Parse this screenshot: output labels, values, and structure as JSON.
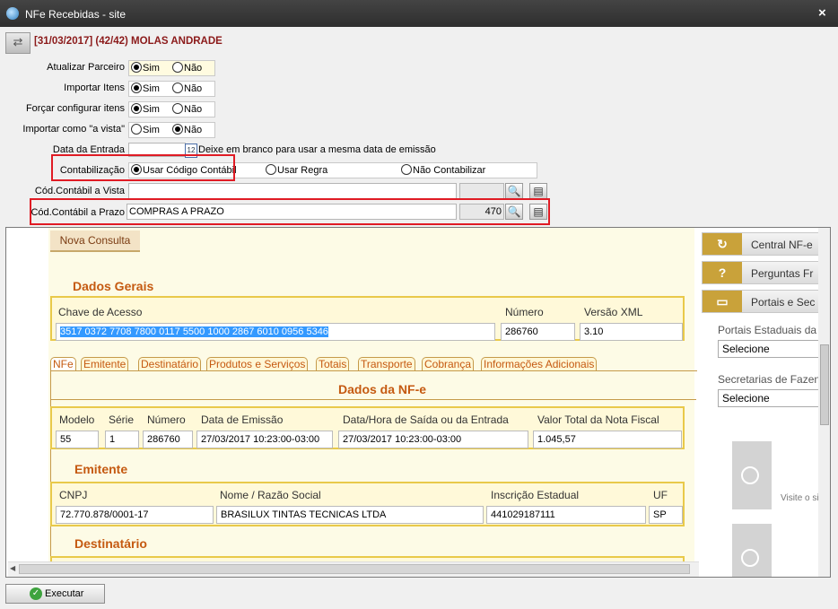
{
  "window": {
    "title": "NFe Recebidas - site",
    "close": "×"
  },
  "header": {
    "title": "[31/03/2017] (42/42) MOLAS ANDRADE"
  },
  "form": {
    "atualizar_parceiro": {
      "label": "Atualizar Parceiro",
      "options": [
        "Sim",
        "Não"
      ],
      "selected": "Sim"
    },
    "importar_itens": {
      "label": "Importar Itens",
      "options": [
        "Sim",
        "Não"
      ],
      "selected": "Sim"
    },
    "forcar_configurar": {
      "label": "Forçar configurar itens",
      "options": [
        "Sim",
        "Não"
      ],
      "selected": "Sim"
    },
    "importar_vista": {
      "label": "Importar como \"a vista\"",
      "options": [
        "Sim",
        "Não"
      ],
      "selected": "Não"
    },
    "data_entrada": {
      "label": "Data da Entrada",
      "value": "",
      "hint": "Deixe em branco para usar a mesma data de emissão",
      "calendar_num": "12"
    },
    "contabilizacao": {
      "label": "Contabilização",
      "options": [
        "Usar Código Contábil",
        "Usar Regra",
        "Não Contabilizar"
      ],
      "selected": "Usar Código Contábil"
    },
    "cod_vista": {
      "label": "Cód.Contábil a Vista",
      "value": "",
      "code": ""
    },
    "cod_prazo": {
      "label": "Cód.Contábil a Prazo",
      "value": "COMPRAS A PRAZO",
      "code": "470"
    }
  },
  "browser": {
    "nova_consulta": "Nova Consulta",
    "dados_gerais": {
      "title": "Dados Gerais",
      "chave_label": "Chave de Acesso",
      "chave_value": "3517 0372 7708 7800 0117 5500 1000 2867 6010 0956 5346",
      "numero_label": "Número",
      "numero_value": "286760",
      "versao_label": "Versão XML",
      "versao_value": "3.10"
    },
    "tabs": [
      "NFe",
      "Emitente",
      "Destinatário",
      "Produtos e Serviços",
      "Totais",
      "Transporte",
      "Cobrança",
      "Informações Adicionais"
    ],
    "dados_nfe": {
      "title": "Dados da NF-e",
      "modelo_label": "Modelo",
      "modelo_value": "55",
      "serie_label": "Série",
      "serie_value": "1",
      "numero_label": "Número",
      "numero_value": "286760",
      "emissao_label": "Data de Emissão",
      "emissao_value": "27/03/2017 10:23:00-03:00",
      "saida_label": "Data/Hora de Saída ou da Entrada",
      "saida_value": "27/03/2017 10:23:00-03:00",
      "valor_label": "Valor Total da Nota Fiscal",
      "valor_value": "1.045,57"
    },
    "emitente": {
      "title": "Emitente",
      "cnpj_label": "CNPJ",
      "cnpj_value": "72.770.878/0001-17",
      "nome_label": "Nome / Razão Social",
      "nome_value": "BRASILUX TINTAS TECNICAS LTDA",
      "ie_label": "Inscrição Estadual",
      "ie_value": "441029187111",
      "uf_label": "UF",
      "uf_value": "SP"
    },
    "destinatario": {
      "title": "Destinatário"
    },
    "right_panel": {
      "buttons": [
        {
          "label": "Central NF-e",
          "icon": "refresh-icon"
        },
        {
          "label": "Perguntas Fr",
          "icon": "question-icon"
        },
        {
          "label": "Portais e Sec",
          "icon": "portal-icon"
        }
      ],
      "portais_label": "Portais Estaduais da",
      "portais_select": "Selecione",
      "secretarias_label": "Secretarias de Fazen",
      "secretarias_select": "Selecione",
      "banner1_text": "Visite o si"
    }
  },
  "footer": {
    "execute": "Executar"
  }
}
